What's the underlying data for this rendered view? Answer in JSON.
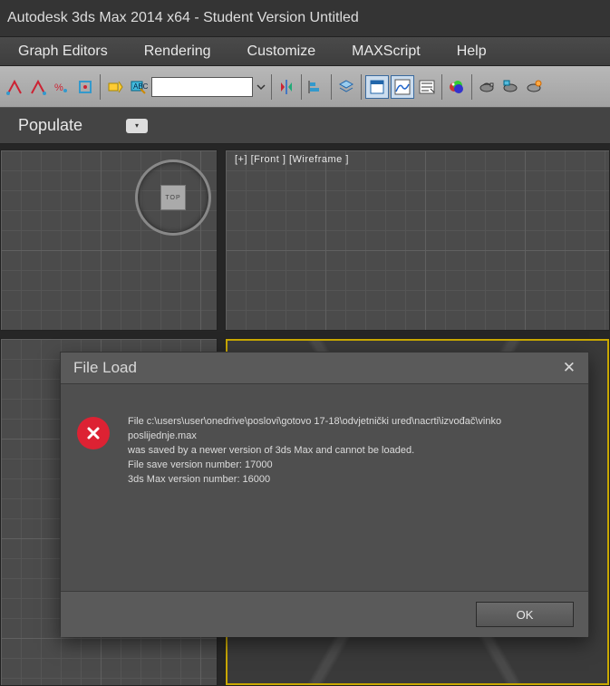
{
  "window": {
    "title": "Autodesk 3ds Max  2014 x64  - Student Version    Untitled"
  },
  "menu": {
    "graph_editors": "Graph Editors",
    "rendering": "Rendering",
    "customize": "Customize",
    "maxscript": "MAXScript",
    "help": "Help"
  },
  "ribbon": {
    "populate": "Populate"
  },
  "viewport": {
    "top_cube": "TOP",
    "front_label": "[+] [Front ] [Wireframe ]"
  },
  "dialog": {
    "title": "File Load",
    "line1": "File c:\\users\\user\\onedrive\\poslovi\\gotovo 17-18\\odvjetnički ured\\nacrti\\izvođač\\vinko poslijednje.max",
    "line2": "was saved by a newer version of 3ds Max and cannot be loaded.",
    "line3": "File save version number: 17000",
    "line4": "3ds Max version number: 16000",
    "ok": "OK"
  }
}
